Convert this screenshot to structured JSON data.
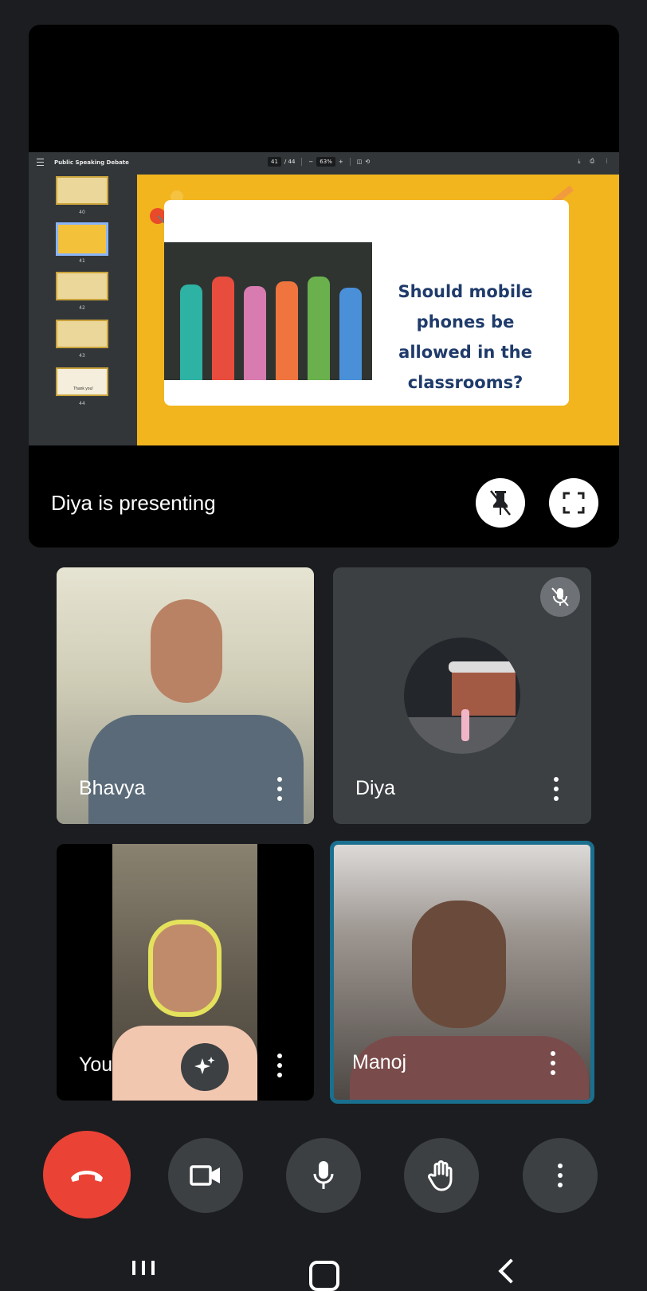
{
  "presentation": {
    "presenting_label": "Diya is presenting",
    "viewer": {
      "doc_title": "Public Speaking Debate",
      "page_current": "41",
      "page_total": "/ 44",
      "zoom": "63%",
      "thumbnails": [
        {
          "num": "40"
        },
        {
          "num": "41",
          "active": true
        },
        {
          "num": "42"
        },
        {
          "num": "43"
        },
        {
          "num": "44",
          "text": "Thank you!"
        }
      ],
      "slide_text": "Should mobile phones be allowed in the classrooms?"
    }
  },
  "participants": [
    {
      "name": "Bhavya",
      "muted": false
    },
    {
      "name": "Diya",
      "muted": true
    },
    {
      "name": "You",
      "muted": false
    },
    {
      "name": "Manoj",
      "muted": false,
      "active_speaker": true
    }
  ],
  "controls": {
    "end_call_color": "#ea4335",
    "button_color": "#3c4043",
    "accent_speaker_border": "#1a6f8f"
  }
}
